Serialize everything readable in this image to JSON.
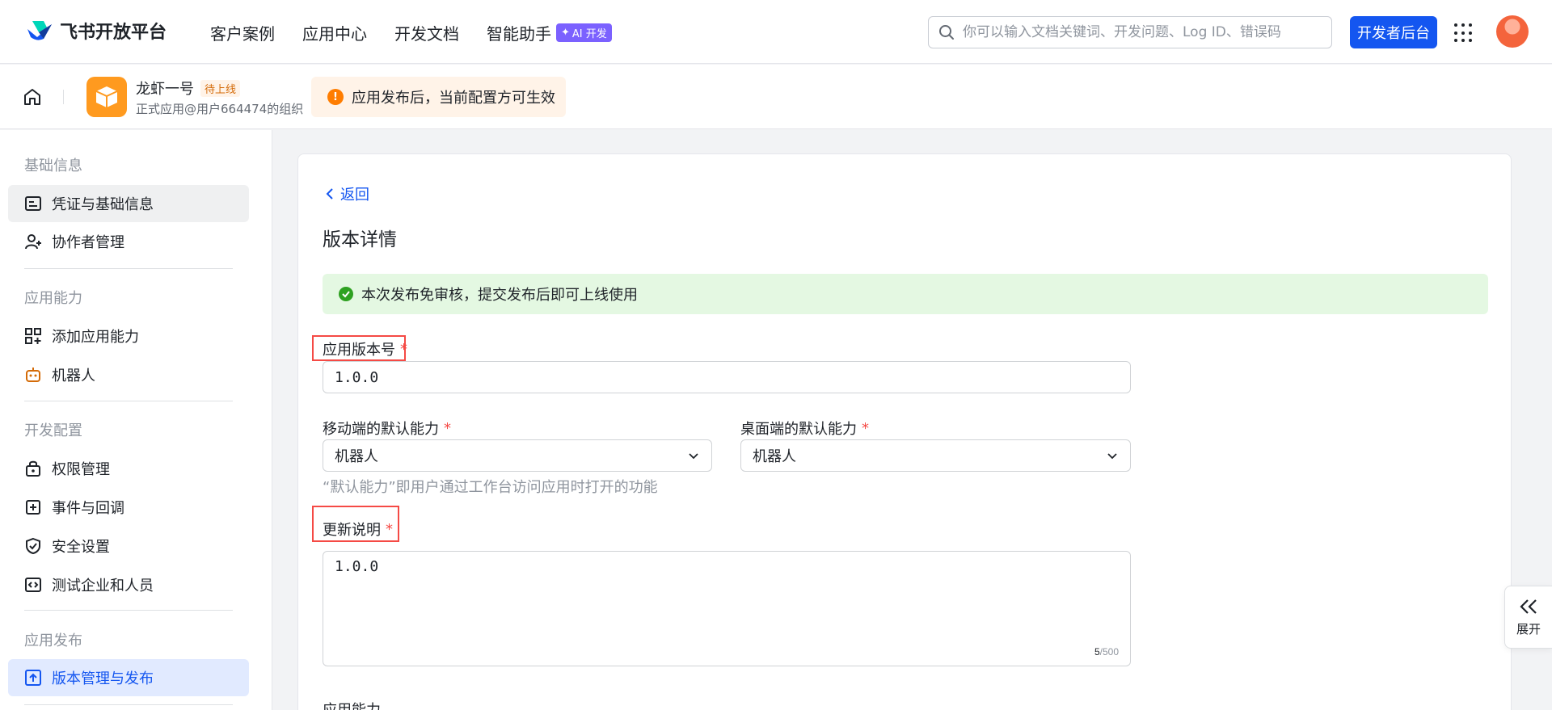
{
  "header": {
    "brand": "飞书开放平台",
    "nav": [
      "客户案例",
      "应用中心",
      "开发文档",
      "智能助手"
    ],
    "ai_badge": "AI 开发",
    "search_placeholder": "你可以输入文档关键词、开发问题、Log ID、错误码",
    "dev_console": "开发者后台"
  },
  "app": {
    "name": "龙虾一号",
    "status": "待上线",
    "subtitle": "正式应用@用户664474的组织",
    "notice": "应用发布后，当前配置方可生效"
  },
  "sidebar": {
    "sections": [
      {
        "title": "基础信息",
        "items": [
          "凭证与基础信息",
          "协作者管理"
        ]
      },
      {
        "title": "应用能力",
        "items": [
          "添加应用能力",
          "机器人"
        ]
      },
      {
        "title": "开发配置",
        "items": [
          "权限管理",
          "事件与回调",
          "安全设置",
          "测试企业和人员"
        ]
      },
      {
        "title": "应用发布",
        "items": [
          "版本管理与发布"
        ]
      }
    ]
  },
  "main": {
    "back": "返回",
    "title": "版本详情",
    "success_msg": "本次发布免审核，提交发布后即可上线使用",
    "version_label": "应用版本号",
    "version_value": "1.0.0",
    "mobile_label": "移动端的默认能力",
    "mobile_value": "机器人",
    "desktop_label": "桌面端的默认能力",
    "desktop_value": "机器人",
    "default_hint": "“默认能力”即用户通过工作台访问应用时打开的功能",
    "notes_label": "更新说明",
    "notes_value": "1.0.0",
    "notes_count": "5",
    "notes_max": "/500",
    "next_section": "应用能力",
    "required_mark": "*"
  },
  "expand": "展开",
  "colors": {
    "primary": "#1456f0",
    "success_bg": "#e4f8e2",
    "warning_bg": "#fff3e8",
    "highlight": "#f54a45"
  }
}
